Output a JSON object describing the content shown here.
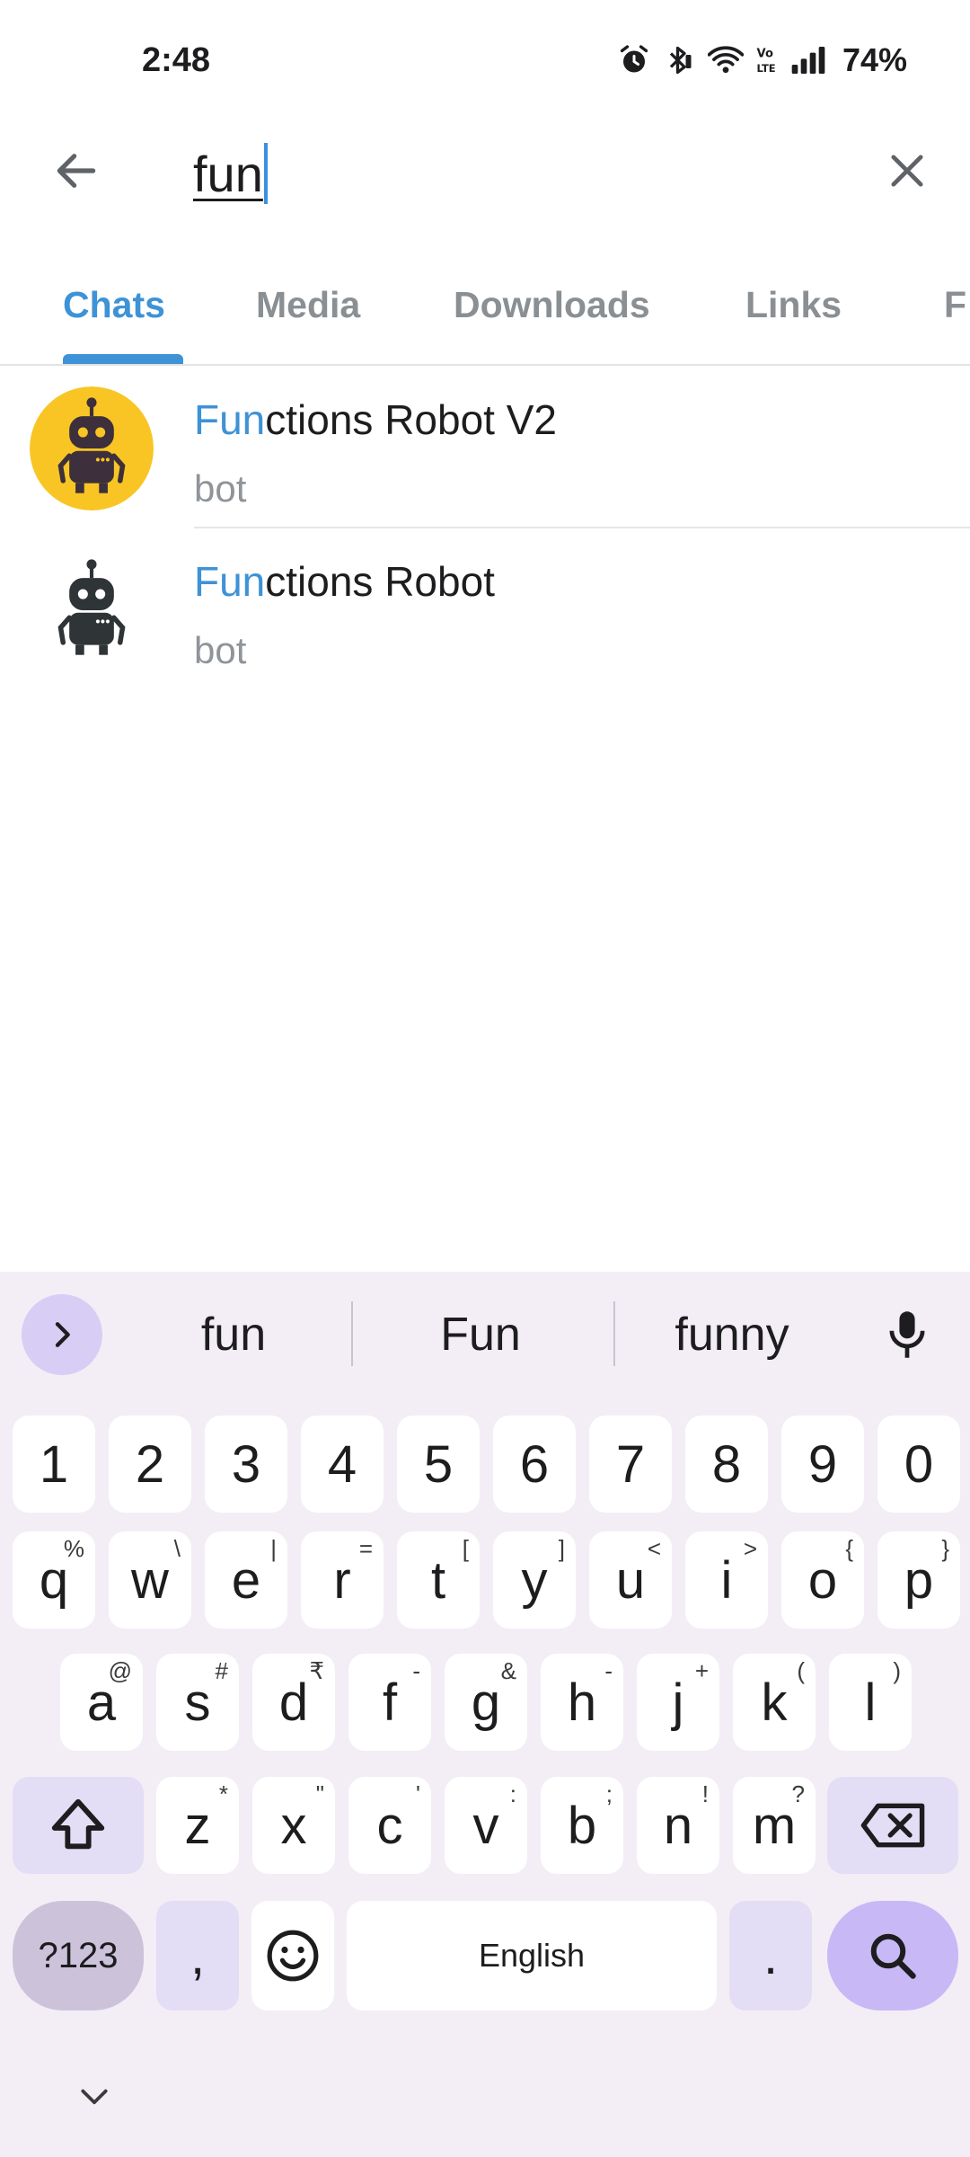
{
  "status_bar": {
    "time": "2:48",
    "battery": "74%"
  },
  "search": {
    "query": "fun"
  },
  "tabs": [
    {
      "label": "Chats",
      "active": true
    },
    {
      "label": "Media"
    },
    {
      "label": "Downloads"
    },
    {
      "label": "Links"
    },
    {
      "label": "F"
    }
  ],
  "results": [
    {
      "title_highlight": "Fun",
      "title_rest": "ctions Robot V2",
      "subtitle": "bot",
      "avatar": "robot-yellow-avatar"
    },
    {
      "title_highlight": "Fun",
      "title_rest": "ctions Robot",
      "subtitle": "bot",
      "avatar": "robot-dark-avatar"
    }
  ],
  "keyboard": {
    "suggestions": [
      "fun",
      "Fun",
      "funny"
    ],
    "number_row": [
      "1",
      "2",
      "3",
      "4",
      "5",
      "6",
      "7",
      "8",
      "9",
      "0"
    ],
    "row1": [
      [
        "q",
        "%"
      ],
      [
        "w",
        "\\"
      ],
      [
        "e",
        "|"
      ],
      [
        "r",
        "="
      ],
      [
        "t",
        "["
      ],
      [
        "y",
        "]"
      ],
      [
        "u",
        "<"
      ],
      [
        "i",
        ">"
      ],
      [
        "o",
        "{"
      ],
      [
        "p",
        "}"
      ]
    ],
    "row2": [
      [
        "a",
        "@"
      ],
      [
        "s",
        "#"
      ],
      [
        "d",
        "₹"
      ],
      [
        "f",
        "-"
      ],
      [
        "g",
        "&"
      ],
      [
        "h",
        "-"
      ],
      [
        "j",
        "+"
      ],
      [
        "k",
        "("
      ],
      [
        "l",
        ")"
      ]
    ],
    "row3": [
      [
        "z",
        "*"
      ],
      [
        "x",
        "\""
      ],
      [
        "c",
        "'"
      ],
      [
        "v",
        ":"
      ],
      [
        "b",
        ";"
      ],
      [
        "n",
        "!"
      ],
      [
        "m",
        "?"
      ]
    ],
    "symbols_label": "?123",
    "comma": ",",
    "space_label": "English",
    "period": "."
  },
  "colors": {
    "accent": "#3e92d6",
    "keyboard_bg": "#f3eef5",
    "search_key": "#c8b8f6"
  }
}
